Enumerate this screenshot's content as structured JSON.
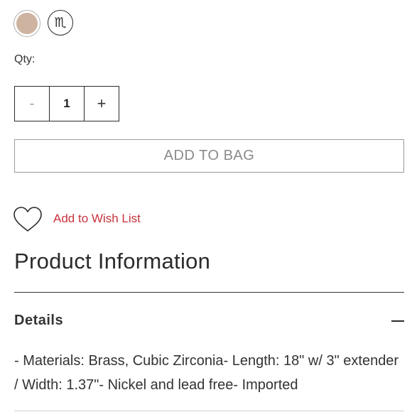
{
  "swatches": [
    {
      "name": "color-swatch",
      "color": "#cdb3a0",
      "selected": true
    },
    {
      "name": "symbol-swatch",
      "symbol": "♏"
    }
  ],
  "quantity": {
    "label": "Qty:",
    "minus": "-",
    "value": "1",
    "plus": "+"
  },
  "actions": {
    "add_to_bag": "ADD TO BAG",
    "wish_list": "Add to Wish List"
  },
  "product_info": {
    "title": "Product Information",
    "details": {
      "label": "Details",
      "text": "- Materials: Brass, Cubic Zirconia- Length: 18\" w/ 3\" extender / Width: 1.37\"- Nickel and lead free- Imported"
    }
  },
  "colors": {
    "accent": "#c8323c",
    "swatch": "#cdb3a0"
  },
  "icons": {
    "heart": "heart-icon",
    "collapse": "minus-icon"
  }
}
